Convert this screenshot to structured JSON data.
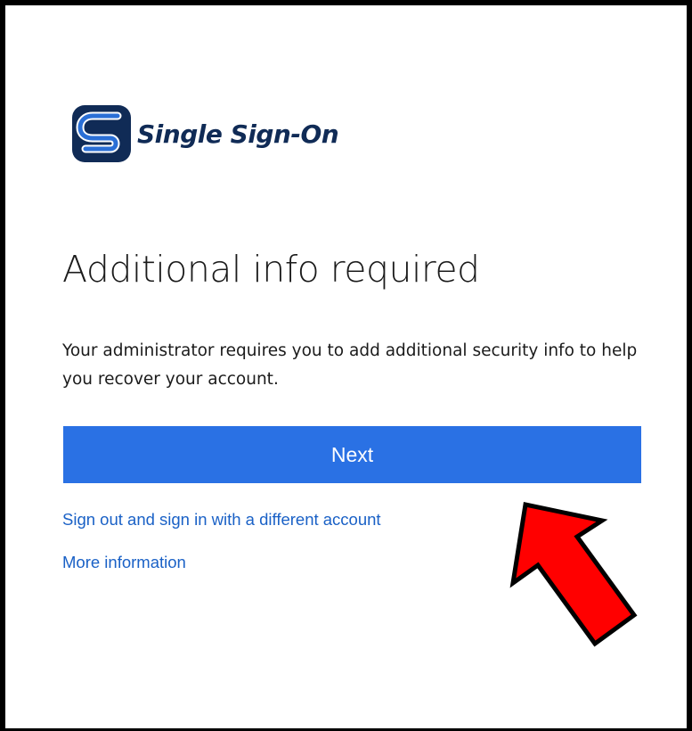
{
  "logo": {
    "text": "Single Sign-On",
    "colors": {
      "navy": "#102b56",
      "blue": "#2a6fd6"
    }
  },
  "page": {
    "title": "Additional info required",
    "description": "Your administrator requires you to add additional security info to help you recover your account."
  },
  "actions": {
    "next_label": "Next",
    "next_color": "#2a71e4"
  },
  "links": {
    "sign_out": "Sign out and sign in with a different account",
    "more_info": "More information",
    "color": "#1a61c6"
  },
  "annotation": {
    "icon": "red-arrow-icon",
    "color": "#ff0000"
  }
}
